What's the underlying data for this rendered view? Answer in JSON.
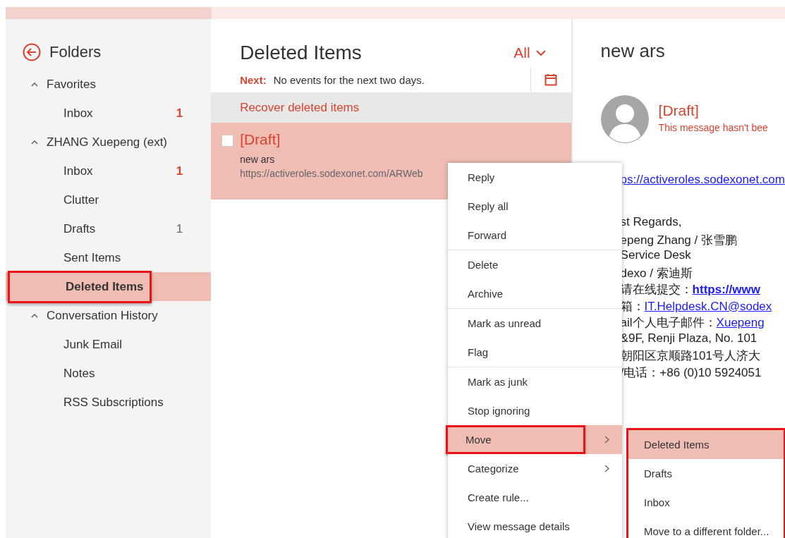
{
  "sidebar": {
    "title": "Folders",
    "items": [
      {
        "label": "Favorites",
        "expanded": true,
        "children": [
          {
            "label": "Inbox",
            "count": "1",
            "unread": true,
            "selected": false
          }
        ]
      },
      {
        "label": "ZHANG Xuepeng (ext)",
        "expanded": true,
        "children": [
          {
            "label": "Inbox",
            "count": "1",
            "unread": true,
            "selected": false
          },
          {
            "label": "Clutter",
            "selected": false
          },
          {
            "label": "Drafts",
            "count": "1",
            "unread": false,
            "selected": false
          },
          {
            "label": "Sent Items",
            "selected": false
          },
          {
            "label": "Deleted Items",
            "selected": true,
            "annotated": true
          },
          {
            "label": "Conversation History",
            "expanded": true,
            "selected": false,
            "outdent": true
          },
          {
            "label": "Junk Email",
            "selected": false
          },
          {
            "label": "Notes",
            "selected": false
          },
          {
            "label": "RSS Subscriptions",
            "selected": false
          }
        ]
      }
    ]
  },
  "message_list": {
    "title": "Deleted Items",
    "filter": "All",
    "next_label": "Next:",
    "next_text": "No events for the next two days.",
    "recover": "Recover deleted items",
    "messages": [
      {
        "title": "[Draft]",
        "subject": "new ars",
        "preview": "https://activeroles.sodexonet.com/ARWeb",
        "selected": true,
        "checked": false
      }
    ]
  },
  "reading_pane": {
    "subject": "new ars",
    "sender": "[Draft]",
    "notice": "This message hasn't bee",
    "link": "ps://activeroles.sodexonet.com",
    "signature": [
      {
        "text": "st Regards,"
      },
      {
        "text": "epeng Zhang / 张雪鹏"
      },
      {
        "text": "Service Desk"
      },
      {
        "text": "dexo / 索迪斯"
      },
      {
        "text": "请在线提交：",
        "link": "https://www"
      },
      {
        "text": "箱：",
        "link": "IT.Helpdesk.CN@sodex"
      },
      {
        "text": "ail个人电子邮件：",
        "link": "Xuepeng"
      },
      {
        "text": "&9F, Renji Plaza, No. 101"
      },
      {
        "text": "朝阳区京顺路101号人济大"
      },
      {
        "text": "/电话：+86 (0)10 5924051"
      }
    ]
  },
  "context_menu": {
    "items": [
      {
        "label": "Reply",
        "selected": false
      },
      {
        "label": "Reply all",
        "selected": false
      },
      {
        "label": "Forward",
        "selected": false,
        "separator_after": true
      },
      {
        "label": "Delete",
        "selected": false
      },
      {
        "label": "Archive",
        "selected": false,
        "separator_after": true
      },
      {
        "label": "Mark as unread",
        "selected": false
      },
      {
        "label": "Flag",
        "selected": false,
        "separator_after": true
      },
      {
        "label": "Mark as junk",
        "selected": false
      },
      {
        "label": "Stop ignoring",
        "selected": false
      },
      {
        "label": "Move",
        "selected": true,
        "submenu": true,
        "annotated": true
      },
      {
        "label": "Categorize",
        "selected": false,
        "submenu": true
      },
      {
        "label": "Create rule...",
        "selected": false
      },
      {
        "label": "View message details",
        "selected": false
      }
    ]
  },
  "submenu": {
    "annotated": true,
    "items": [
      {
        "label": "Deleted Items",
        "selected": true
      },
      {
        "label": "Drafts",
        "selected": false
      },
      {
        "label": "Inbox",
        "selected": false
      },
      {
        "label": "Move to a different folder...",
        "selected": false
      }
    ]
  }
}
